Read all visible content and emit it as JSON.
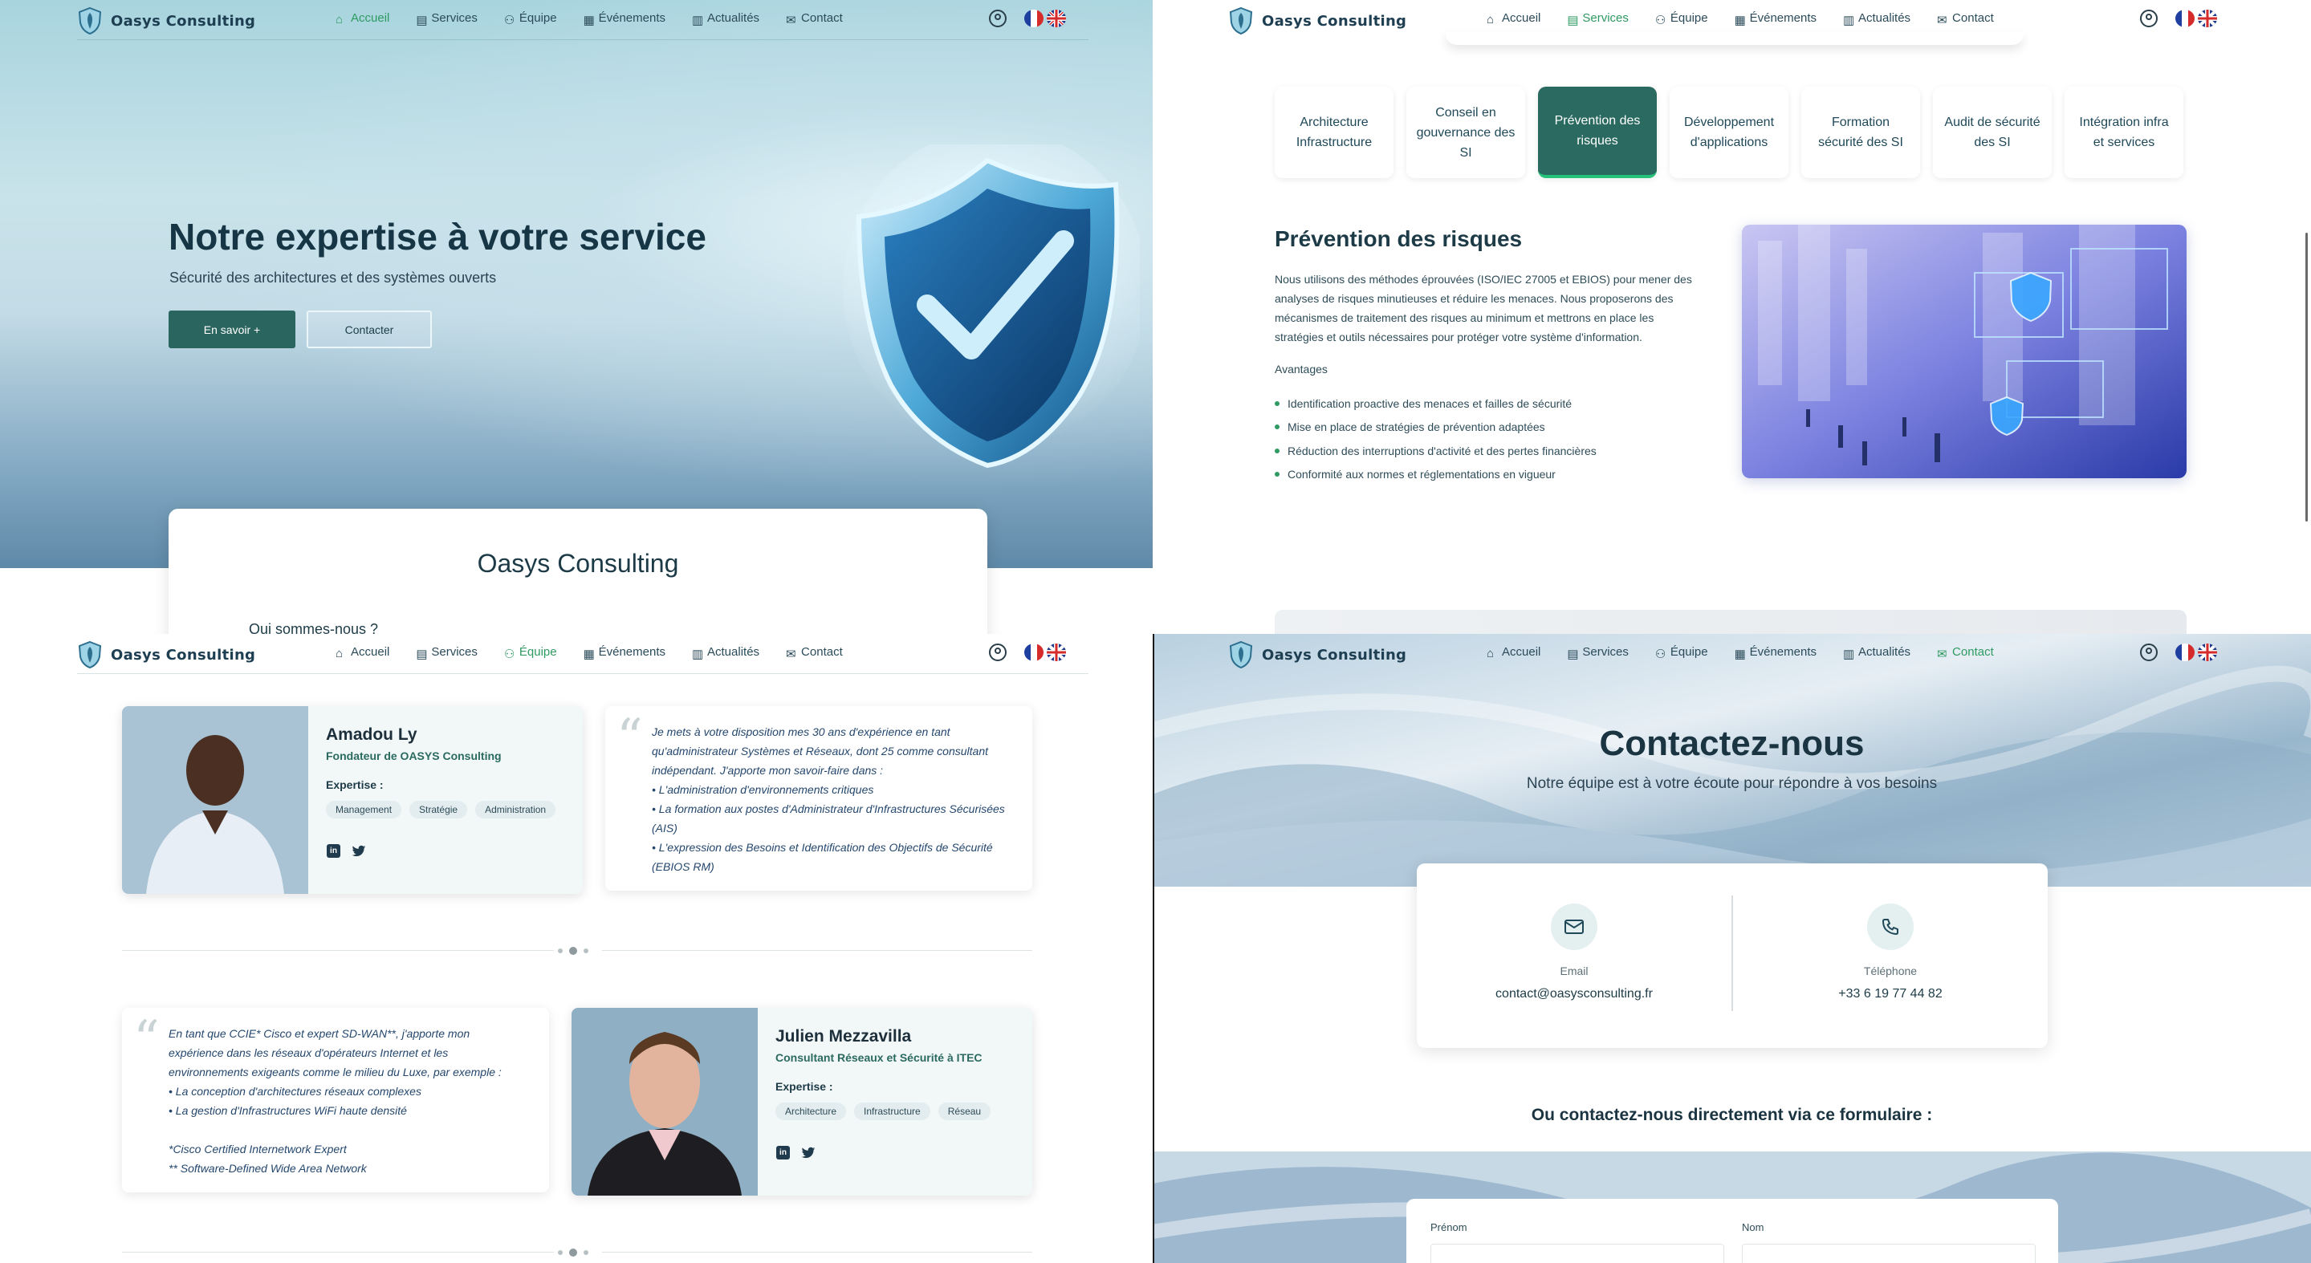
{
  "nav": {
    "brand": "Oasys Consulting",
    "links": [
      "Accueil",
      "Services",
      "Équipe",
      "Événements",
      "Actualités",
      "Contact"
    ]
  },
  "hero": {
    "title": "Notre expertise à votre service",
    "subtitle": "Sécurité des architectures et des systèmes ouverts",
    "cta_primary": "En savoir +",
    "cta_secondary": "Contacter",
    "card_title": "Oasys Consulting",
    "card_cut_text": "Qui sommes-nous ?"
  },
  "services": {
    "tabs": [
      "Architecture Infrastructure",
      "Conseil en gouvernance des SI",
      "Prévention des risques",
      "Développement d'applications",
      "Formation sécurité des SI",
      "Audit de sécurité des SI",
      "Intégration infra et services"
    ],
    "active_tab": 2,
    "title": "Prévention des risques",
    "description": "Nous utilisons des méthodes éprouvées (ISO/IEC 27005 et EBIOS) pour mener des analyses de risques minutieuses et réduire les menaces. Nous proposerons des mécanismes de traitement des risques au minimum et mettrons en place les stratégies et outils nécessaires pour protéger votre système d'information.",
    "advantages_title": "Avantages",
    "advantages": [
      "Identification proactive des menaces et failles de sécurité",
      "Mise en place de stratégies de prévention adaptées",
      "Réduction des interruptions d'activité et des pertes financières",
      "Conformité aux normes et réglementations en vigueur"
    ]
  },
  "team": {
    "members": [
      {
        "name": "Amadou Ly",
        "role": "Fondateur de OASYS Consulting",
        "expertise_label": "Expertise :",
        "skills": [
          "Management",
          "Stratégie",
          "Administration"
        ],
        "quote": "Je mets à votre disposition mes 30 ans d'expérience en tant\nqu'administrateur Systèmes et Réseaux, dont 25 comme consultant\nindépendant. J'apporte mon savoir-faire dans :\n• L'administration d'environnements critiques\n• La formation aux postes d'Administrateur d'Infrastructures Sécurisées\n(AIS)\n• L'expression des Besoins et Identification des Objectifs de Sécurité\n(EBIOS RM)"
      },
      {
        "name": "Julien Mezzavilla",
        "role": "Consultant Réseaux et Sécurité à ITEC",
        "expertise_label": "Expertise :",
        "skills": [
          "Architecture",
          "Infrastructure",
          "Réseau"
        ],
        "quote": "En tant que CCIE* Cisco et expert SD-WAN**, j'apporte mon\nexpérience dans les réseaux d'opérateurs Internet et les\nenvironnements exigeants comme le milieu du Luxe, par exemple :\n• La conception d'architectures réseaux complexes\n• La gestion d'Infrastructures WiFi haute densité\n\n*Cisco Certified Internetwork Expert\n** Software-Defined Wide Area Network"
      }
    ]
  },
  "contact": {
    "title": "Contactez-nous",
    "subtitle": "Notre équipe est à votre écoute pour répondre à vos besoins",
    "email_label": "Email",
    "email_value": "contact@oasysconsulting.fr",
    "phone_label": "Téléphone",
    "phone_value": "+33 6 19 77 44 82",
    "form_heading": "Ou contactez-nous directement via ce formulaire :",
    "first_name_label": "Prénom",
    "last_name_label": "Nom"
  },
  "colors": {
    "accent_green": "#2f9a62",
    "primary_teal": "#2a655f",
    "text_dark": "#1d3b47"
  }
}
